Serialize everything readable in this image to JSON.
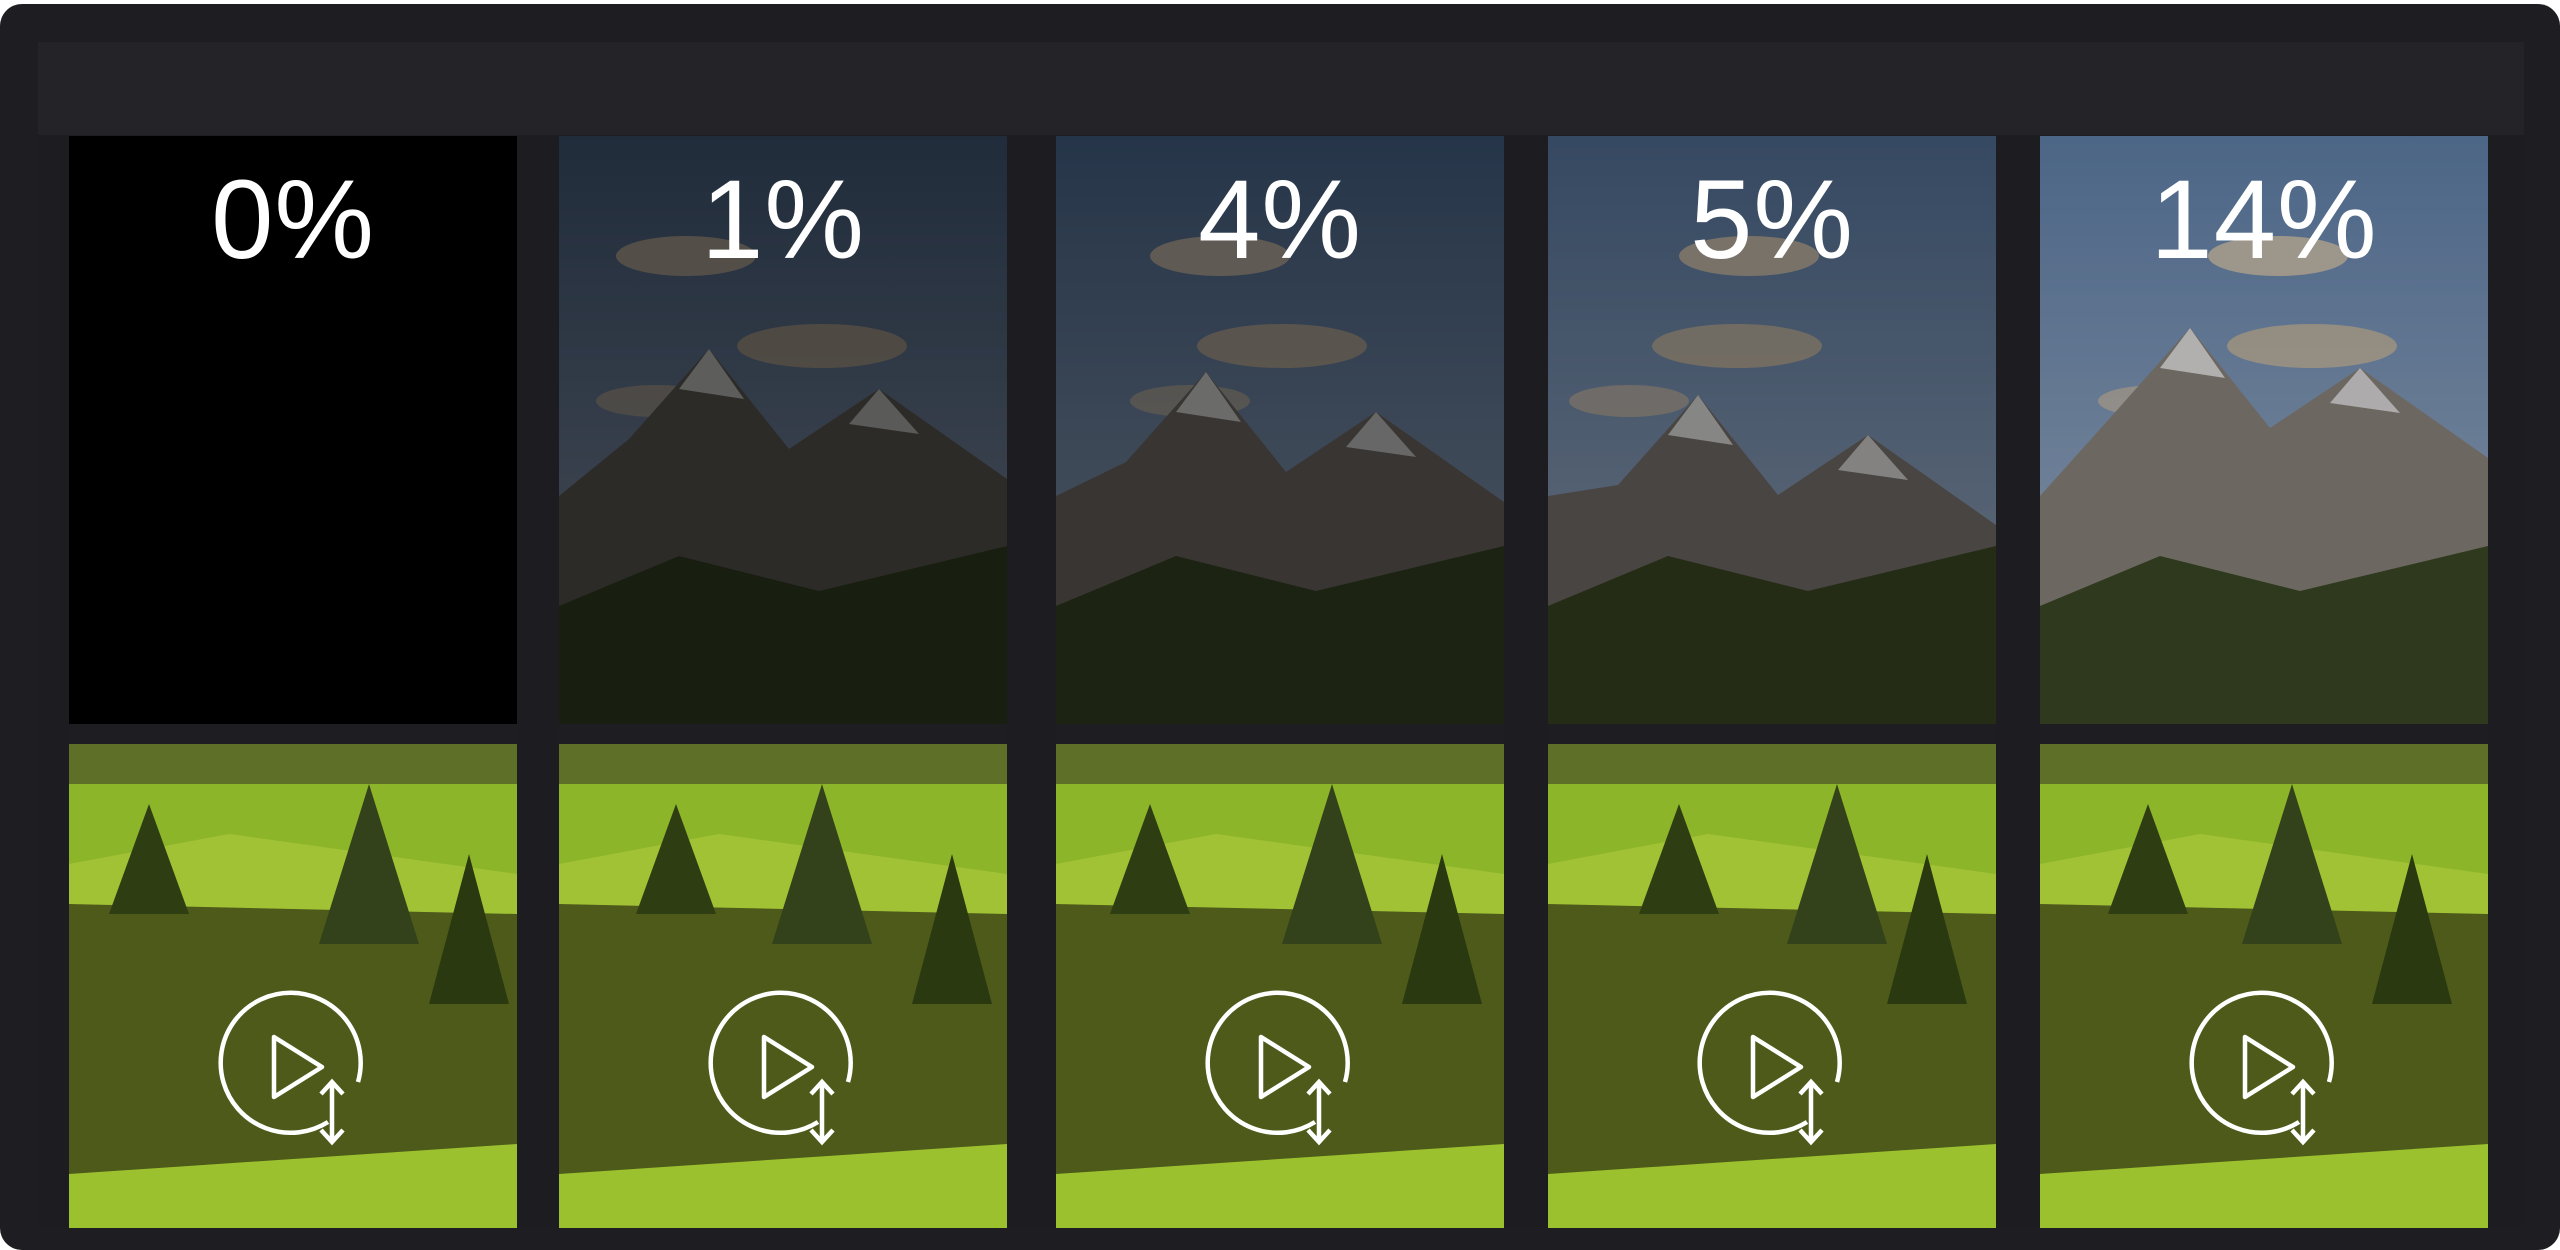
{
  "tiles": [
    {
      "label": "0%",
      "shade": 1.0,
      "sky_color": "#10161f",
      "peak_color": "#2a2a2c",
      "icon": "play-swap-icon"
    },
    {
      "label": "1%",
      "shade": 0.58,
      "sky_color": "#4f6a8e",
      "peak_color": "#6b6660",
      "icon": "play-swap-icon"
    },
    {
      "label": "4%",
      "shade": 0.52,
      "sky_color": "#4f6f98",
      "peak_color": "#75706b",
      "icon": "play-swap-icon"
    },
    {
      "label": "5%",
      "shade": 0.4,
      "sky_color": "#5a7aa3",
      "peak_color": "#7b746e",
      "icon": "play-swap-icon"
    },
    {
      "label": "14%",
      "shade": 0.22,
      "sky_color": "#6283ad",
      "peak_color": "#8b847c",
      "icon": "play-swap-icon"
    }
  ],
  "colors": {
    "background": "#1e1d21",
    "topbar": "#242327",
    "grass": "#8db52a",
    "forest": "#4d5a1a",
    "text": "#ffffff"
  }
}
